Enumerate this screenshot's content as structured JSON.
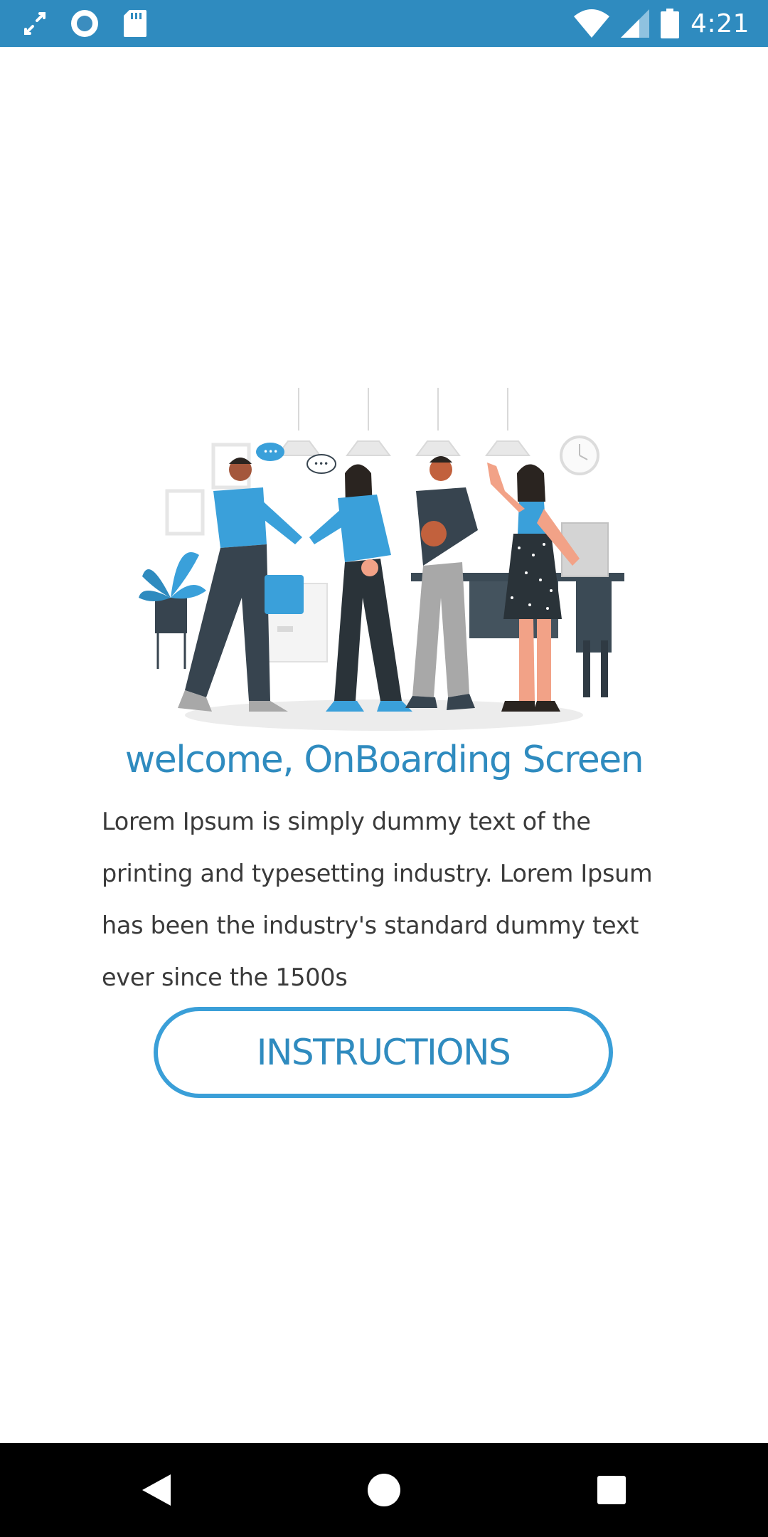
{
  "status_bar": {
    "time": "4:21",
    "left_icons": [
      "auto-rotate-icon",
      "sync-circle-icon",
      "sd-card-icon"
    ],
    "right_icons": [
      "wifi-icon",
      "cellular-signal-icon",
      "battery-icon"
    ]
  },
  "main": {
    "illustration_name": "team-handshake-illustration",
    "title": "welcome, OnBoarding Screen",
    "description": "Lorem Ipsum is simply dummy text of the printing and typesetting industry. Lorem Ipsum has been the industry's standard dummy text ever since the 1500s",
    "button_label": "INSTRUCTIONS"
  },
  "nav_bar": {
    "buttons": [
      "back-icon",
      "home-icon",
      "recents-icon"
    ]
  },
  "colors": {
    "status_bar": "#2f8bbf",
    "accent": "#2f8bbf",
    "button_border": "#3a9fd8",
    "text": "#3a3a3a",
    "nav_bar": "#000000"
  }
}
